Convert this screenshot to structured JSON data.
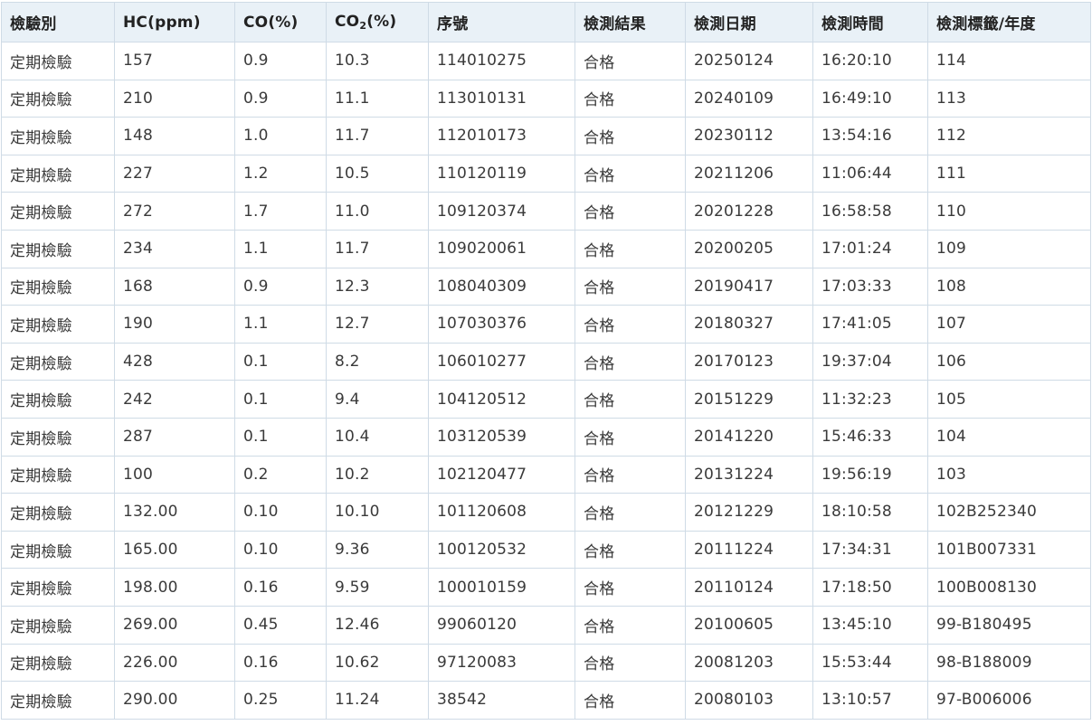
{
  "columns": [
    {
      "label": "檢驗別"
    },
    {
      "label": "HC(ppm)"
    },
    {
      "label": "CO(%)"
    },
    {
      "prefix": "CO",
      "sub": "2",
      "suffix": "(%)"
    },
    {
      "label": "序號"
    },
    {
      "label": "檢測結果"
    },
    {
      "label": "檢測日期"
    },
    {
      "label": "檢測時間"
    },
    {
      "label": "檢測標籤/年度"
    }
  ],
  "rows": [
    [
      "定期檢驗",
      "157",
      "0.9",
      "10.3",
      "114010275",
      "合格",
      "20250124",
      "16:20:10",
      "114"
    ],
    [
      "定期檢驗",
      "210",
      "0.9",
      "11.1",
      "113010131",
      "合格",
      "20240109",
      "16:49:10",
      "113"
    ],
    [
      "定期檢驗",
      "148",
      "1.0",
      "11.7",
      "112010173",
      "合格",
      "20230112",
      "13:54:16",
      "112"
    ],
    [
      "定期檢驗",
      "227",
      "1.2",
      "10.5",
      "110120119",
      "合格",
      "20211206",
      "11:06:44",
      "111"
    ],
    [
      "定期檢驗",
      "272",
      "1.7",
      "11.0",
      "109120374",
      "合格",
      "20201228",
      "16:58:58",
      "110"
    ],
    [
      "定期檢驗",
      "234",
      "1.1",
      "11.7",
      "109020061",
      "合格",
      "20200205",
      "17:01:24",
      "109"
    ],
    [
      "定期檢驗",
      "168",
      "0.9",
      "12.3",
      "108040309",
      "合格",
      "20190417",
      "17:03:33",
      "108"
    ],
    [
      "定期檢驗",
      "190",
      "1.1",
      "12.7",
      "107030376",
      "合格",
      "20180327",
      "17:41:05",
      "107"
    ],
    [
      "定期檢驗",
      "428",
      "0.1",
      "8.2",
      "106010277",
      "合格",
      "20170123",
      "19:37:04",
      "106"
    ],
    [
      "定期檢驗",
      "242",
      "0.1",
      "9.4",
      "104120512",
      "合格",
      "20151229",
      "11:32:23",
      "105"
    ],
    [
      "定期檢驗",
      "287",
      "0.1",
      "10.4",
      "103120539",
      "合格",
      "20141220",
      "15:46:33",
      "104"
    ],
    [
      "定期檢驗",
      "100",
      "0.2",
      "10.2",
      "102120477",
      "合格",
      "20131224",
      "19:56:19",
      "103"
    ],
    [
      "定期檢驗",
      "132.00",
      "0.10",
      "10.10",
      "101120608",
      "合格",
      "20121229",
      "18:10:58",
      "102B252340"
    ],
    [
      "定期檢驗",
      "165.00",
      "0.10",
      "9.36",
      "100120532",
      "合格",
      "20111224",
      "17:34:31",
      "101B007331"
    ],
    [
      "定期檢驗",
      "198.00",
      "0.16",
      "9.59",
      "100010159",
      "合格",
      "20110124",
      "17:18:50",
      "100B008130"
    ],
    [
      "定期檢驗",
      "269.00",
      "0.45",
      "12.46",
      "99060120",
      "合格",
      "20100605",
      "13:45:10",
      "99-B180495"
    ],
    [
      "定期檢驗",
      "226.00",
      "0.16",
      "10.62",
      "97120083",
      "合格",
      "20081203",
      "15:53:44",
      "98-B188009"
    ],
    [
      "定期檢驗",
      "290.00",
      "0.25",
      "11.24",
      "38542",
      "合格",
      "20080103",
      "13:10:57",
      "97-B006006"
    ]
  ]
}
